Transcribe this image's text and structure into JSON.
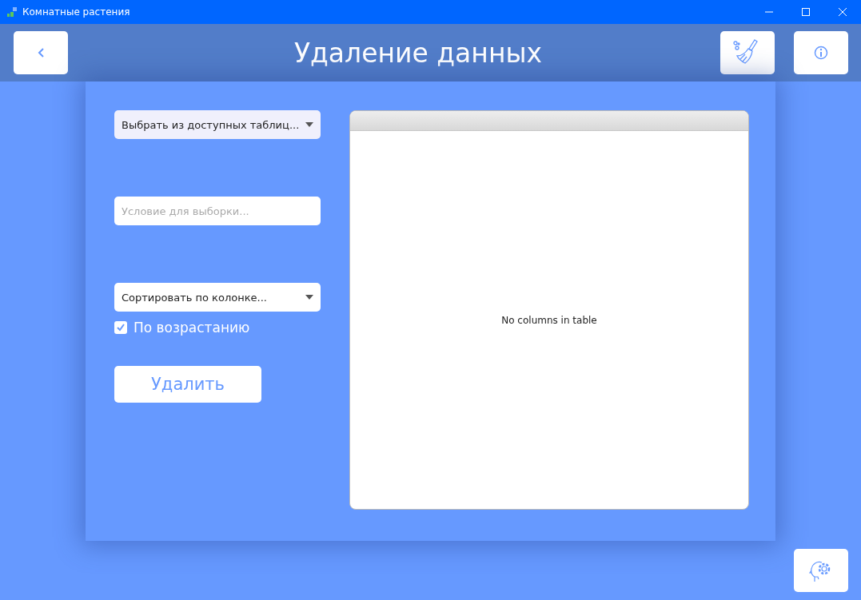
{
  "window": {
    "title": "Комнатные растения"
  },
  "header": {
    "title": "Удаление данных"
  },
  "table_select": {
    "placeholder": "Выбрать из доступных таблиц..."
  },
  "condition": {
    "placeholder": "Условие для выборки..."
  },
  "sort_select": {
    "placeholder": "Сортировать по колонке..."
  },
  "ascending": {
    "label": "По возрастанию",
    "checked": true
  },
  "delete_button": {
    "label": "Удалить"
  },
  "table": {
    "empty_message": "No columns in table"
  }
}
